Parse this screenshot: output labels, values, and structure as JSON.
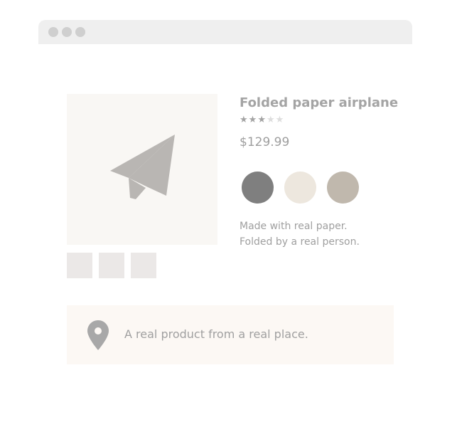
{
  "window": {
    "controls": [
      "window-dot",
      "window-dot",
      "window-dot"
    ]
  },
  "product": {
    "title": "Folded paper airplane",
    "rating": {
      "filled": 3,
      "total": 5
    },
    "price": "$129.99",
    "swatches": [
      {
        "name": "dark-gray",
        "color": "#7f7f7f"
      },
      {
        "name": "cream",
        "color": "#ede7de"
      },
      {
        "name": "taupe",
        "color": "#c0b8ad"
      }
    ],
    "description_lines": [
      "Made with real paper.",
      "Folded by a real person."
    ],
    "image_icon": "paper-plane-icon",
    "thumbnail_count": 3
  },
  "banner": {
    "icon": "map-pin-icon",
    "text": "A real product from a real place."
  },
  "colors": {
    "window_bar": "#efefef",
    "window_dot": "#cfcfcf",
    "image_bg": "#f9f7f4",
    "thumbnail_bg": "#ebe8e7",
    "banner_bg": "#fcf8f4",
    "plane": "#b9b6b3",
    "pin": "#a8a8a8"
  }
}
